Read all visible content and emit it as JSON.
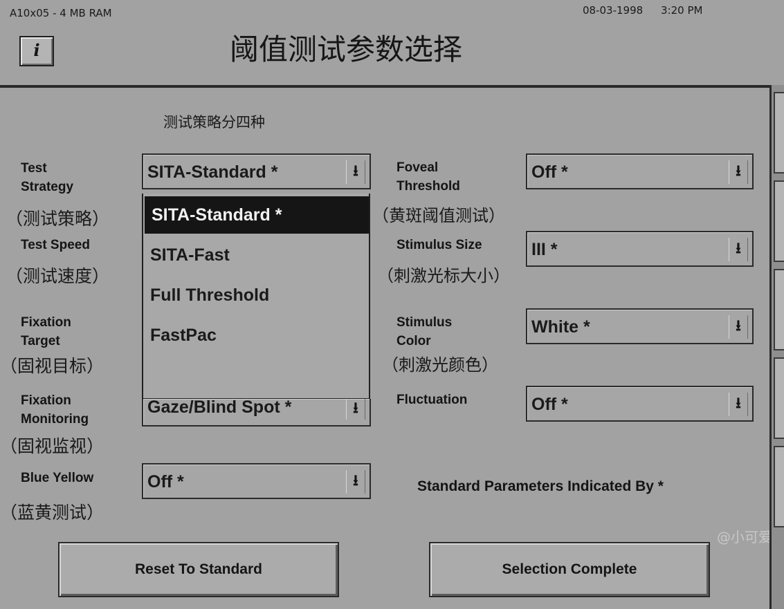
{
  "header": {
    "system_info": "A10x05 - 4 MB RAM",
    "date": "08-03-1998",
    "time": "3:20 PM",
    "title": "阈值测试参数选择",
    "info_button_label": "i"
  },
  "subtitle": "测试策略分四种",
  "left_fields": {
    "test_strategy": {
      "label": "Test Strategy",
      "label_line1": "Test",
      "label_line2": "Strategy",
      "cn": "（测试策略）",
      "value": "SITA-Standard  *",
      "arrow": "⭳"
    },
    "test_speed": {
      "label": "Test Speed",
      "cn": "（测试速度）"
    },
    "fixation_target": {
      "label_line1": "Fixation",
      "label_line2": "Target",
      "cn": "（固视目标）"
    },
    "fixation_monitoring": {
      "label_line1": "Fixation",
      "label_line2": "Monitoring",
      "cn": "（固视监视）",
      "value": "Gaze/Blind Spot *",
      "arrow": "⭳"
    },
    "blue_yellow": {
      "label": "Blue Yellow",
      "cn": "（蓝黄测试）",
      "value": "Off  *",
      "arrow": "⭳"
    }
  },
  "dropdown": {
    "options": [
      "SITA-Standard  *",
      "SITA-Fast",
      "Full Threshold",
      "FastPac"
    ],
    "selected_index": 0
  },
  "right_fields": {
    "foveal_threshold": {
      "label_line1": "Foveal",
      "label_line2": "Threshold",
      "cn": "（黄斑阈值测试）",
      "value": "Off  *",
      "arrow": "⭳"
    },
    "stimulus_size": {
      "label": "Stimulus Size",
      "cn": "（刺激光标大小）",
      "value": "III  *",
      "arrow": "⭳"
    },
    "stimulus_color": {
      "label_line1": "Stimulus",
      "label_line2": "Color",
      "cn": "（刺激光颜色）",
      "value": "White  *",
      "arrow": "⭳"
    },
    "fluctuation": {
      "label": "Fluctuation",
      "value": "Off  *",
      "arrow": "⭳"
    }
  },
  "standard_note": "Standard Parameters Indicated By *",
  "buttons": {
    "reset": "Reset To Standard",
    "complete": "Selection Complete"
  },
  "watermark": "@小可爱"
}
